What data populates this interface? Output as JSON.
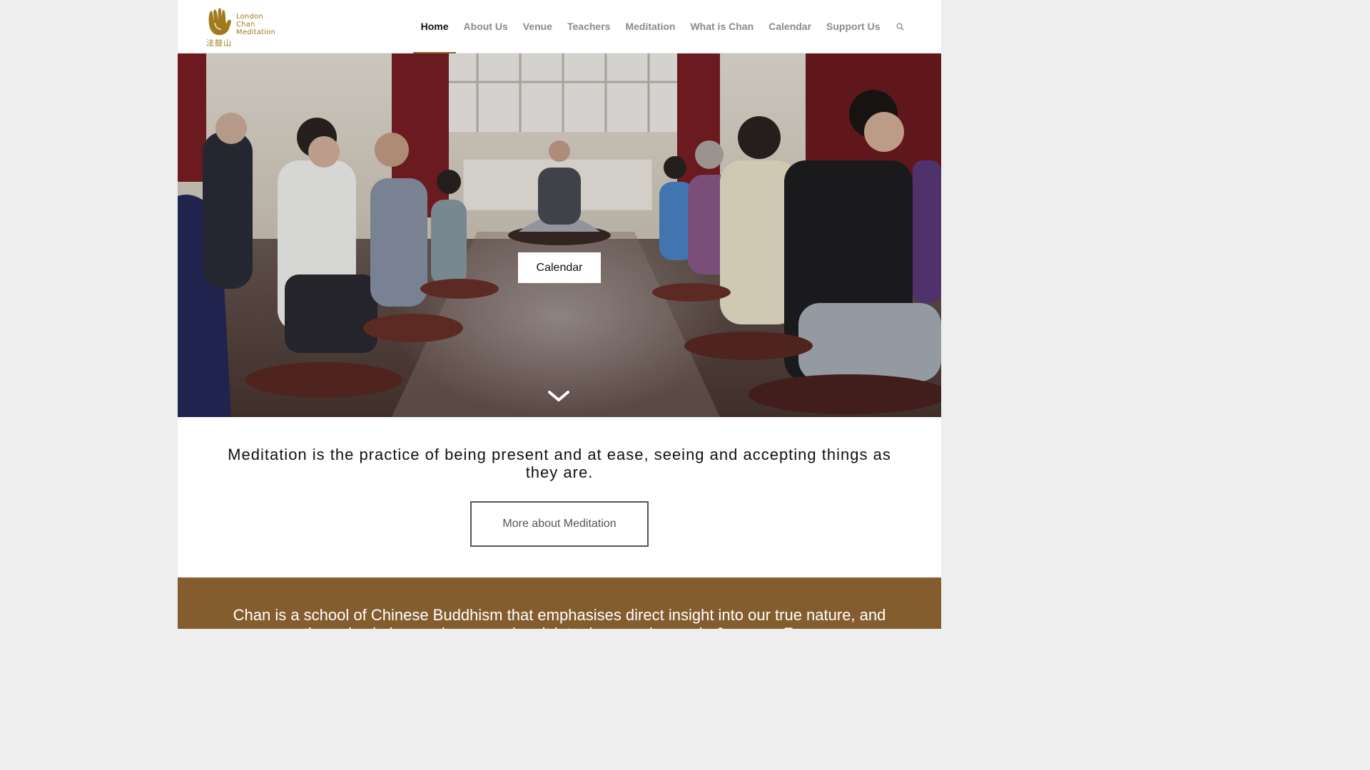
{
  "brand": {
    "name_lines": [
      "London",
      "Chan",
      "Meditation"
    ],
    "cjk": "法鼓山",
    "color": "#a07a1e"
  },
  "nav": {
    "items": [
      {
        "label": "Home",
        "active": true
      },
      {
        "label": "About Us"
      },
      {
        "label": "Venue"
      },
      {
        "label": "Teachers"
      },
      {
        "label": "Meditation"
      },
      {
        "label": "What is Chan"
      },
      {
        "label": "Calendar"
      },
      {
        "label": "Support Us"
      }
    ],
    "search_icon": "search-icon",
    "active_underline_color": "#8a6330"
  },
  "hero": {
    "button_label": "Calendar",
    "scroll_icon": "chevron-down-icon"
  },
  "intro": {
    "quote": "Meditation is the practice of being present and at ease, seeing and accepting things as they are.",
    "button_label": "More about Meditation"
  },
  "chan": {
    "text": "Chan is a school of Chinese Buddhism that emphasises direct insight into our true nature, and through wisdom and compassion, it later became known in Japan as Zen.",
    "background": "#845d2e"
  }
}
